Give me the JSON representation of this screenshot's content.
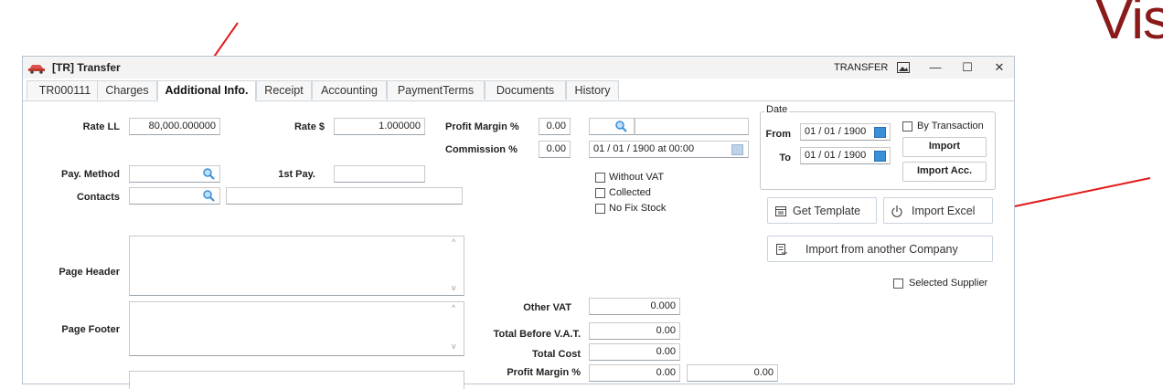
{
  "background_text": "Vis",
  "window": {
    "title": "[TR] Transfer",
    "code_label": "TRANSFER",
    "controls": {
      "minimize": "—",
      "maximize": "☐",
      "close": "✕"
    }
  },
  "tabs": [
    {
      "label": "TR000111"
    },
    {
      "label": "Charges"
    },
    {
      "label": "Additional Info."
    },
    {
      "label": "Receipt"
    },
    {
      "label": "Accounting"
    },
    {
      "label": "PaymentTerms"
    },
    {
      "label": "Documents"
    },
    {
      "label": "History"
    }
  ],
  "form": {
    "rate_ll": {
      "label": "Rate LL",
      "value": "80,000.000000"
    },
    "rate_usd": {
      "label": "Rate $",
      "value": "1.000000"
    },
    "profit_margin": {
      "label": "Profit Margin %",
      "value": "0.00"
    },
    "commission": {
      "label": "Commission %",
      "value": "0.00"
    },
    "commission_date": {
      "value": "01 / 01 / 1900 at 00:00"
    },
    "pay_method": {
      "label": "Pay. Method",
      "value": ""
    },
    "first_pay": {
      "label": "1st Pay.",
      "value": ""
    },
    "contacts": {
      "label": "Contacts",
      "value": ""
    },
    "page_header": {
      "label": "Page Header",
      "value": ""
    },
    "page_footer": {
      "label": "Page Footer",
      "value": ""
    },
    "without_vat": {
      "label": "Without VAT",
      "checked": false
    },
    "collected": {
      "label": "Collected",
      "checked": false
    },
    "no_fix_stock": {
      "label": "No Fix Stock",
      "checked": false
    }
  },
  "date_group": {
    "title": "Date",
    "from_label": "From",
    "from_value": "01 / 01 / 1900",
    "to_label": "To",
    "to_value": "01 / 01 / 1900",
    "by_transaction": {
      "label": "By Transaction",
      "checked": false
    },
    "import_label": "Import",
    "import_acc_label": "Import Acc."
  },
  "buttons": {
    "get_template": "Get Template",
    "import_excel": "Import Excel",
    "import_company": "Import from another Company"
  },
  "selected_supplier": {
    "label": "Selected Supplier",
    "checked": false
  },
  "totals": {
    "other_vat": {
      "label": "Other VAT",
      "value": "0.000"
    },
    "total_before_vat": {
      "label": "Total Before V.A.T.",
      "value": "0.00"
    },
    "total_cost": {
      "label": "Total Cost",
      "value": "0.00"
    },
    "profit_margin": {
      "label": "Profit Margin %",
      "value": "0.00",
      "value2": "0.00"
    }
  },
  "colors": {
    "annotation_arrow": "#e21b1b",
    "icon_blue": "#3a8fd6",
    "accent_text": "#8b1a1a"
  }
}
